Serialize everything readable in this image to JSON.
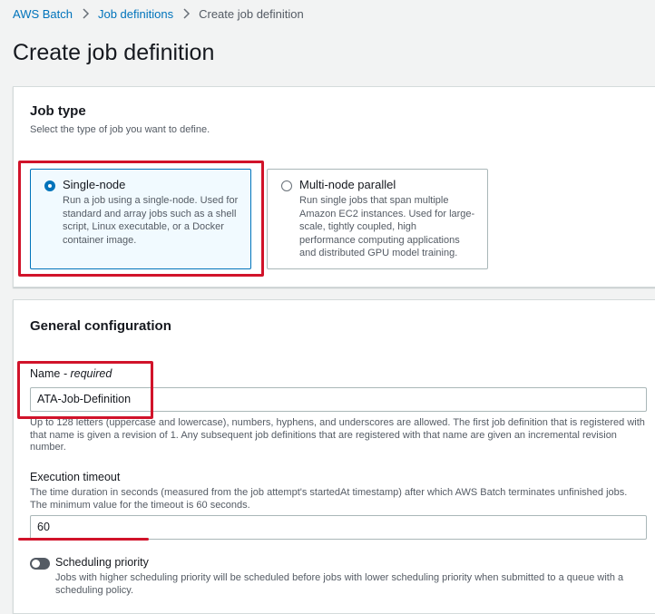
{
  "breadcrumb": {
    "items": [
      "AWS Batch",
      "Job definitions"
    ],
    "current": "Create job definition"
  },
  "page": {
    "title": "Create job definition"
  },
  "job_type": {
    "header": "Job type",
    "description": "Select the type of job you want to define.",
    "options": [
      {
        "label": "Single-node",
        "description_lines": [
          "Run a job using a single-node. Used for",
          "standard and array jobs such as a shell",
          "script, Linux executable, or a Docker",
          "container image."
        ],
        "selected": true
      },
      {
        "label": "Multi-node parallel",
        "description_lines": [
          "Run single jobs that span multiple",
          "Amazon EC2 instances. Used for large-",
          "scale, tightly coupled, high",
          "performance computing applications",
          "and distributed GPU model training."
        ],
        "selected": false
      }
    ]
  },
  "general": {
    "header": "General configuration",
    "name_label": "Name",
    "name_required": " - required",
    "name_value": "ATA-Job-Definition",
    "name_hint_lines": [
      "Up to 128 letters (uppercase and lowercase), numbers, hyphens, and underscores are allowed. The first job definition that is registered with",
      "that name is given a revision of 1. Any subsequent job definitions that are registered with that name are given an incremental revision",
      "number."
    ],
    "timeout_label": "Execution timeout",
    "timeout_hint_lines": [
      "The time duration in seconds (measured from the job attempt's startedAt timestamp) after which AWS Batch terminates unfinished jobs.",
      "The minimum value for the timeout is 60 seconds."
    ],
    "timeout_value": "60",
    "scheduling_label": "Scheduling priority",
    "scheduling_enabled": false,
    "scheduling_hint_lines": [
      "Jobs with higher scheduling priority will be scheduled before jobs with lower scheduling priority when submitted to a queue with a",
      "scheduling policy."
    ]
  },
  "colors": {
    "link": "#0073bb",
    "annotation": "#d1132a",
    "selected_tile_bg": "#f1faff"
  }
}
